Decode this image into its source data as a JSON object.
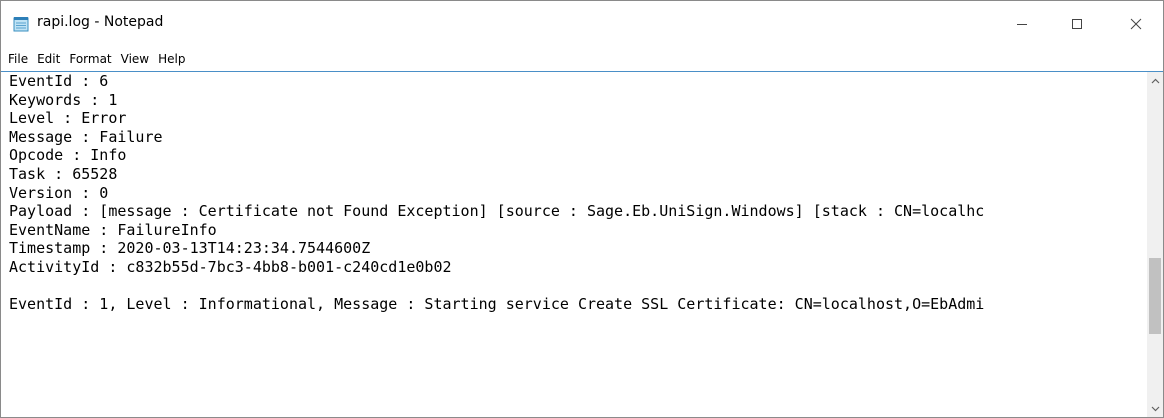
{
  "window": {
    "title": "rapi.log - Notepad"
  },
  "menu": [
    "File",
    "Edit",
    "Format",
    "View",
    "Help"
  ],
  "editor": {
    "lines": [
      "EventId : 6",
      "Keywords : 1",
      "Level : Error",
      "Message : Failure",
      "Opcode : Info",
      "Task : 65528",
      "Version : 0",
      "Payload : [message : Certificate not Found Exception] [source : Sage.Eb.UniSign.Windows] [stack : CN=localhc",
      "EventName : FailureInfo",
      "Timestamp : 2020-03-13T14:23:34.7544600Z",
      "ActivityId : c832b55d-7bc3-4bb8-b001-c240cd1e0b02",
      "",
      "EventId : 1, Level : Informational, Message : Starting service Create SSL Certificate: CN=localhost,O=EbAdmi"
    ]
  },
  "scrollbar": {
    "position": 0.72
  }
}
